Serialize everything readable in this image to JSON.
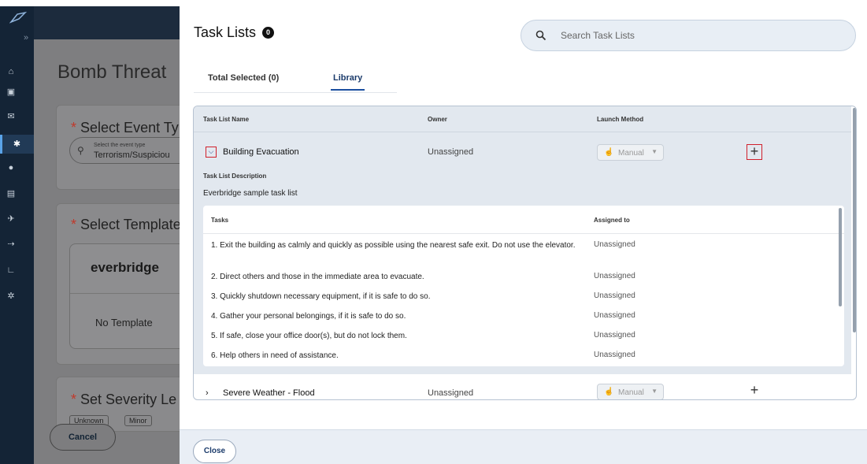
{
  "background_page": {
    "title": "Bomb Threat",
    "section_event_type": "Select Event Ty",
    "event_type_hint": "Select the event type",
    "event_type_value": "Terrorism/Suspiciou",
    "section_template": "Select Template",
    "template_brand": "everbridge",
    "template_none": "No Template",
    "section_severity": "Set Severity Le",
    "severity_chips": [
      "Unknown",
      "Minor"
    ],
    "cancel_label": "Cancel",
    "required_marker": "*"
  },
  "drawer": {
    "title": "Task Lists",
    "count": "0",
    "search_placeholder": "Search Task Lists",
    "tabs": [
      {
        "label": "Total Selected (0)",
        "active": false
      },
      {
        "label": "Library",
        "active": true
      }
    ],
    "columns": {
      "name": "Task List Name",
      "owner": "Owner",
      "launch": "Launch Method"
    },
    "task_lists": [
      {
        "name": "Building Evacuation",
        "owner": "Unassigned",
        "launch": "Manual",
        "expanded": true,
        "description_label": "Task List Description",
        "description": "Everbridge sample task list",
        "tasks_header": "Tasks",
        "assigned_header": "Assigned to",
        "tasks": [
          {
            "text": "1. Exit the building as calmly and quickly as possible using the nearest safe exit. Do not use the elevator.",
            "assigned": "Unassigned"
          },
          {
            "text": "2. Direct others and those in the immediate area to evacuate.",
            "assigned": "Unassigned"
          },
          {
            "text": "3. Quickly shutdown necessary equipment, if it is safe to do so.",
            "assigned": "Unassigned"
          },
          {
            "text": "4. Gather your personal belongings, if it is safe to do so.",
            "assigned": "Unassigned"
          },
          {
            "text": "5. If safe, close your office door(s), but do not lock them.",
            "assigned": "Unassigned"
          },
          {
            "text": "6. Help others in need of assistance.",
            "assigned": "Unassigned"
          }
        ]
      },
      {
        "name": "Severe Weather - Flood",
        "owner": "Unassigned",
        "launch": "Manual",
        "expanded": false
      }
    ],
    "close_label": "Close"
  },
  "colors": {
    "highlight": "#d0202b",
    "accent": "#1b4fa0",
    "nav_bg": "#142436"
  }
}
